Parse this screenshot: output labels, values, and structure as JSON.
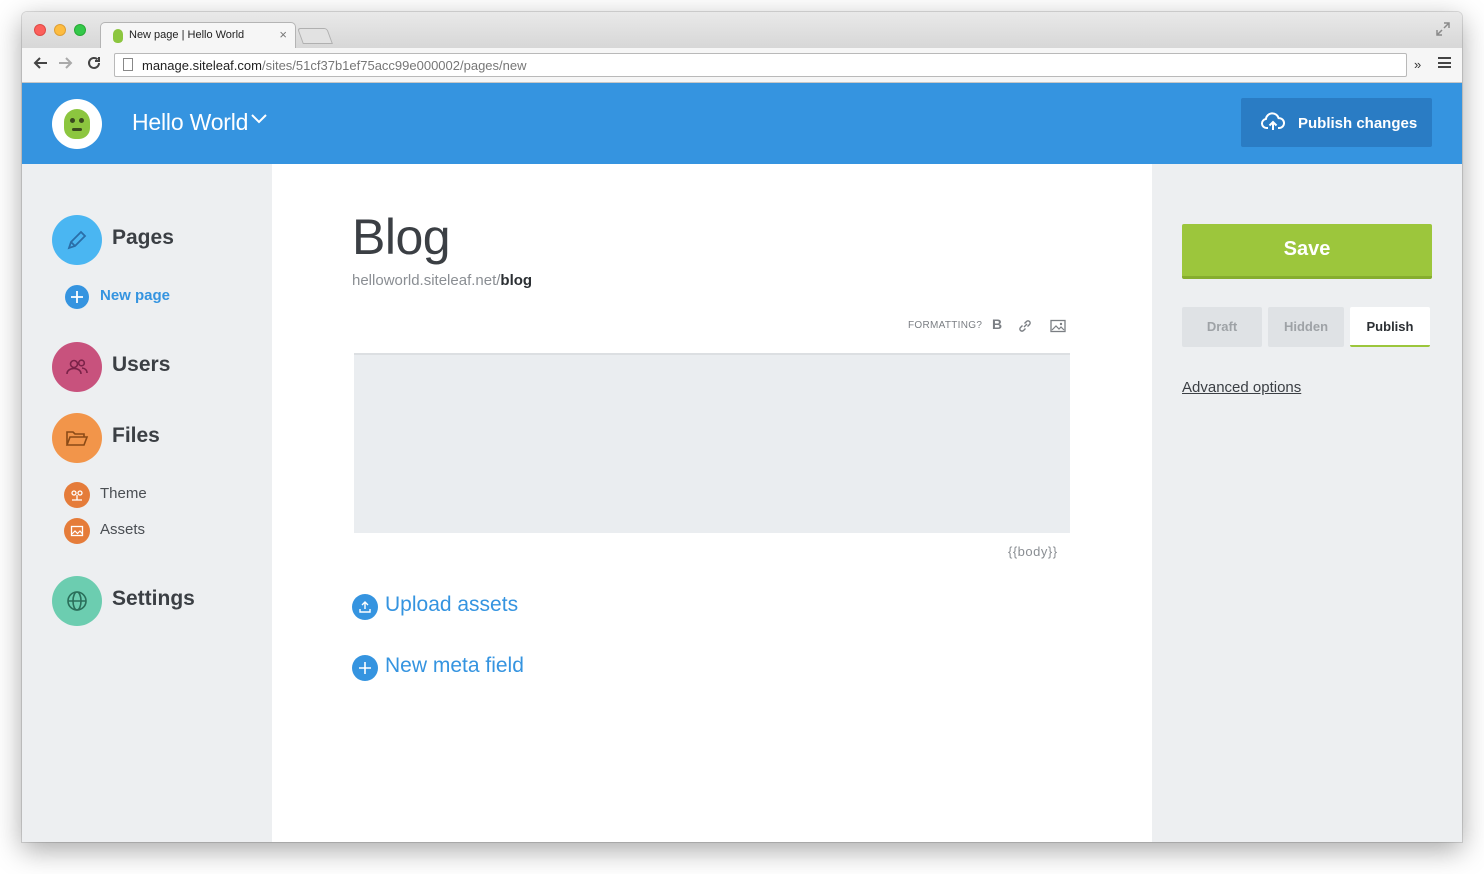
{
  "browser": {
    "tab_title": "New page | Hello World",
    "tab_close": "×",
    "url_domain": "manage.siteleaf.com",
    "url_path": "/sites/51cf37b1ef75acc99e000002/pages/new",
    "more_label": "»"
  },
  "header": {
    "site_name": "Hello World",
    "publish_label": "Publish changes",
    "accent_color": "#3594e0"
  },
  "sidebar": {
    "items": [
      {
        "label": "Pages",
        "icon": "pencil-icon",
        "color": "#4ab6f2"
      },
      {
        "label": "Users",
        "icon": "users-icon",
        "color": "#c8527d"
      },
      {
        "label": "Files",
        "icon": "folder-icon",
        "color": "#f2954a"
      },
      {
        "label": "Settings",
        "icon": "globe-icon",
        "color": "#6ccdb0"
      }
    ],
    "new_page_label": "New page",
    "file_subitems": [
      {
        "label": "Theme",
        "icon": "theme-icon"
      },
      {
        "label": "Assets",
        "icon": "image-icon"
      }
    ]
  },
  "main": {
    "title": "Blog",
    "url_base": "helloworld.siteleaf.net/",
    "url_slug": "blog",
    "formatting_label": "FORMATTING?",
    "bold_label": "B",
    "body_tag": "{{body}}",
    "upload_label": "Upload assets",
    "meta_label": "New meta field"
  },
  "panel": {
    "save_label": "Save",
    "statuses": [
      "Draft",
      "Hidden",
      "Publish"
    ],
    "selected_status": "Publish",
    "advanced_label": "Advanced options",
    "save_color": "#9cc63c"
  }
}
